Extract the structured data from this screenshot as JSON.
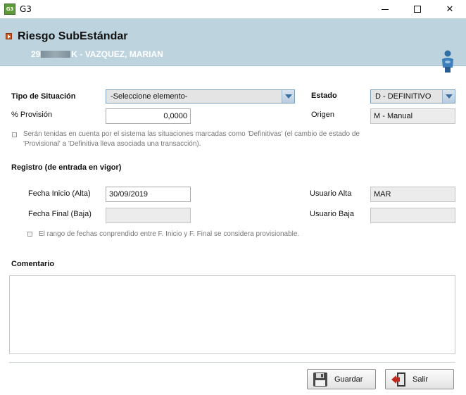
{
  "window": {
    "app_icon_text": "G3",
    "title": "G3",
    "minimize": "",
    "maximize": "",
    "close": "✕"
  },
  "header": {
    "title": "Riesgo SubEstándar",
    "subtitle_prefix": "29",
    "subtitle_suffix": "K - VAZQUEZ, MARIAN",
    "colors": {
      "band": "#bdd3de",
      "bullet": "#c9571e"
    }
  },
  "form": {
    "tipo_situacion": {
      "label": "Tipo de Situación",
      "value": "-Seleccione elemento-"
    },
    "estado": {
      "label": "Estado",
      "value": "D - DEFINITIVO"
    },
    "provision": {
      "label": "% Provisión",
      "value": "0,0000"
    },
    "origen": {
      "label": "Origen",
      "value": "M - Manual"
    },
    "note1_line1": "Serán tenidas en cuenta por el sistema las situaciones marcadas como 'Definitivas' (el cambio de estado de",
    "note1_line2": "'Provisional' a 'Definitiva lleva asociada una transacción)."
  },
  "registro": {
    "heading": "Registro (de entrada en vigor)",
    "fecha_inicio": {
      "label": "Fecha Inicio (Alta)",
      "value": "30/09/2019"
    },
    "usuario_alta": {
      "label": "Usuario Alta",
      "value": "MAR"
    },
    "fecha_final": {
      "label": "Fecha Final (Baja)",
      "value": ""
    },
    "usuario_baja": {
      "label": "Usuario Baja",
      "value": ""
    },
    "note2": "El rango de fechas conprendido entre F. Inicio y F. Final se considera provisionable."
  },
  "comentario": {
    "label": "Comentario",
    "value": ""
  },
  "buttons": {
    "guardar": {
      "label": "Guardar",
      "icon": "floppy-disk-icon"
    },
    "salir": {
      "label": "Salir",
      "icon": "exit-door-icon"
    }
  }
}
